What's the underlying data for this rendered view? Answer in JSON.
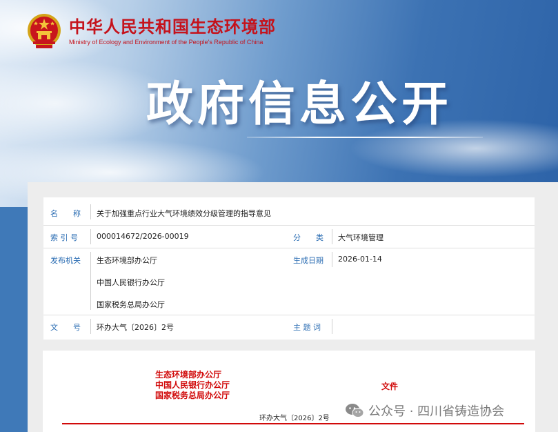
{
  "header": {
    "ministry_cn": "中华人民共和国生态环境部",
    "ministry_en": "Ministry of Ecology and Environment of the People's Republic of China",
    "banner_title": "政府信息公开"
  },
  "info": {
    "name_label": "名　　称",
    "name_value": "关于加强重点行业大气环境绩效分级管理的指导意见",
    "index_label": "索 引 号",
    "index_value": "000014672/2026-00019",
    "category_label": "分　　类",
    "category_value": "大气环境管理",
    "publisher_label": "发布机关",
    "publishers": [
      "生态环境部办公厅",
      "中国人民银行办公厅",
      "国家税务总局办公厅"
    ],
    "date_label": "生成日期",
    "date_value": "2026-01-14",
    "docno_label": "文　　号",
    "docno_value": "环办大气〔2026〕2号",
    "subject_label": "主 题 词",
    "subject_value": ""
  },
  "document": {
    "issuers": [
      "生态环境部办公厅",
      "中国人民银行办公厅",
      "国家税务总局办公厅"
    ],
    "wenjian": "文件",
    "doc_number": "环办大气〔2026〕2号"
  },
  "watermark": {
    "text": "公众号 · 四川省铸造协会",
    "icon": "wechat-icon"
  },
  "colors": {
    "ministry_red": "#c5121b",
    "label_blue": "#2b6db3",
    "doc_red": "#d10a0a"
  }
}
